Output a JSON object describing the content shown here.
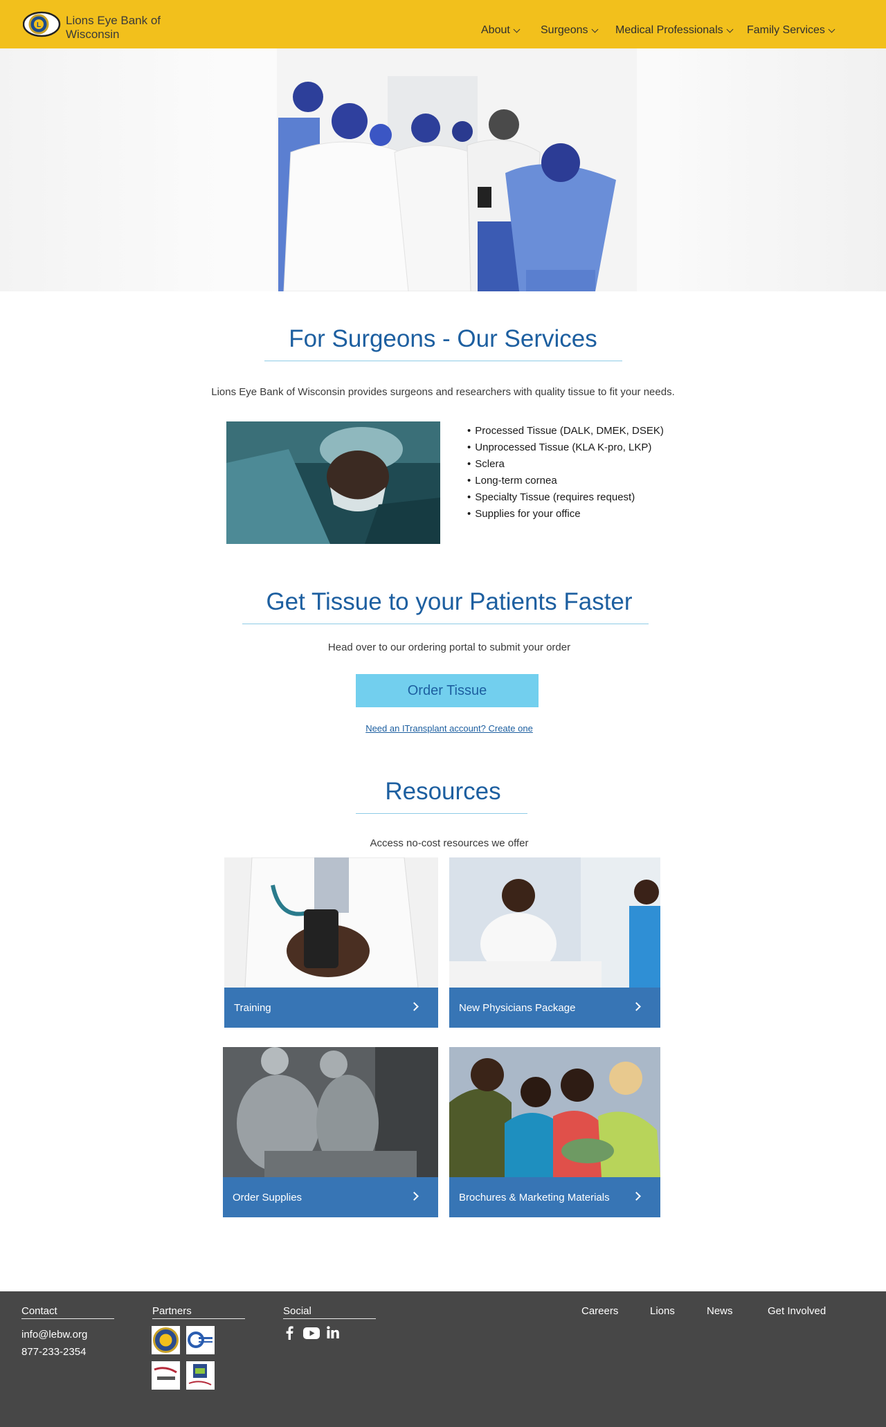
{
  "header": {
    "logo_text": "Lions Eye Bank of Wisconsin",
    "nav": [
      {
        "label": "About"
      },
      {
        "label": "Surgeons"
      },
      {
        "label": "Medical Professionals"
      },
      {
        "label": "Family Services"
      }
    ]
  },
  "services": {
    "title": "For Surgeons - Our Services",
    "intro": "Lions Eye Bank of Wisconsin provides surgeons and researchers with quality tissue to fit your needs.",
    "items": [
      "Processed Tissue (DALK, DMEK, DSEK)",
      "Unprocessed Tissue (KLA K-pro, LKP)",
      "Sclera",
      "Long-term cornea",
      "Specialty Tissue (requires request)",
      "Supplies for your office"
    ]
  },
  "order": {
    "title": "Get Tissue to your Patients Faster",
    "subtitle": "Head over to our ordering portal to submit your order",
    "button_label": "Order Tissue",
    "account_link": "Need an ITransplant account? Create one"
  },
  "resources": {
    "title": "Resources",
    "subtitle": "Access no-cost resources we offer",
    "cards": [
      {
        "label": "Training"
      },
      {
        "label": "New Physicians Package"
      },
      {
        "label": "Order Supplies"
      },
      {
        "label": "Brochures & Marketing Materials"
      }
    ]
  },
  "footer": {
    "contact_heading": "Contact",
    "email": "info@lebw.org",
    "phone": "877-233-2354",
    "partners_heading": "Partners",
    "social_heading": "Social",
    "social_icons": [
      "facebook-icon",
      "youtube-icon",
      "linkedin-icon"
    ],
    "links": [
      "Careers",
      "Lions",
      "News",
      "Get Involved"
    ]
  },
  "colors": {
    "header_bg": "#f2c01c",
    "heading_blue": "#1d5fa0",
    "button_bg": "#72cfee",
    "card_bar": "#3775b5",
    "footer_bg": "#474747"
  }
}
